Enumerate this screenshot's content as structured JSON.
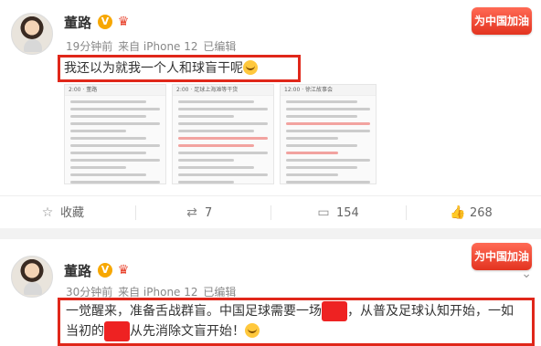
{
  "post1": {
    "author": "董路",
    "meta": [
      "19分钟前",
      "来自 iPhone 12",
      "已编辑"
    ],
    "badge": "为中国加油",
    "text": "我还以为就我一个人和球盲干呢",
    "thumbs": [
      {
        "header": "2:00",
        "title": "董路"
      },
      {
        "header": "2:00",
        "title": "足球上海滩等干货"
      },
      {
        "header": "12:00",
        "title": "徐江故事会"
      }
    ],
    "actions": {
      "collect": "收藏",
      "repost": "7",
      "comment": "154",
      "like": "268"
    }
  },
  "post2": {
    "author": "董路",
    "meta": [
      "30分钟前",
      "来自 iPhone 12",
      "已编辑"
    ],
    "badge": "为中国加油",
    "text_a": "一觉醒来，准备舌战群盲。中国足球需要一场",
    "text_b": "，从普及足球认知开始，一如",
    "text_c": "当初的",
    "text_d": "从先消除文盲开始！"
  },
  "colors": {
    "highlight_box": "#e0271a",
    "badge": "#e33420",
    "verified": "#f7a700"
  }
}
